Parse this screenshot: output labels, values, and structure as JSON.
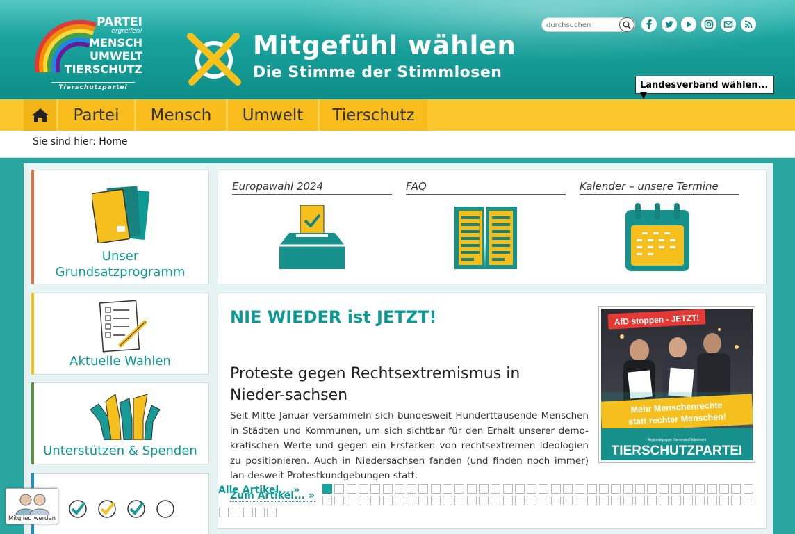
{
  "logo": {
    "line1": "PARTEI",
    "line1_sub": "ergreifen!",
    "line2": "MENSCH",
    "line3": "UMWELT",
    "line4": "TIERSCHUTZ",
    "subtitle": "Tierschutzpartei"
  },
  "claim": {
    "headline": "Mitgefühl wählen",
    "subline": "Die Stimme der Stimmlosen"
  },
  "search": {
    "placeholder": "durchsuchen"
  },
  "social_icons": [
    "facebook-icon",
    "twitter-icon",
    "youtube-icon",
    "instagram-icon",
    "mail-icon",
    "rss-icon"
  ],
  "landesverband": {
    "label": "Landesverband wählen... ▼"
  },
  "nav": {
    "items": [
      "Partei",
      "Mensch",
      "Umwelt",
      "Tierschutz"
    ]
  },
  "breadcrumb": {
    "text": "Sie sind hier: Home"
  },
  "sidebar": {
    "cards": [
      {
        "label": "Unser Grundsatzprogramm",
        "accent": "#e8733a"
      },
      {
        "label": "Aktuelle Wahlen",
        "accent": "#f2c218"
      },
      {
        "label": "Unterstützen & Spenden",
        "accent": "#5a8f3c"
      },
      {
        "label": "",
        "accent": "#1a8fd0"
      }
    ]
  },
  "quicklinks": {
    "items": [
      {
        "label": "Europawahl 2024"
      },
      {
        "label": "FAQ"
      },
      {
        "label": "Kalender – unsere Termine"
      }
    ]
  },
  "article": {
    "kicker": "NIE WIEDER ist JETZT!",
    "title": "Proteste gegen Rechtsextremismus in Nieder-sachsen",
    "body": "Seit Mitte Januar versammeln sich bundesweit Hunderttausende Menschen in Städten und Kommunen, um sich sichtbar für den Erhalt unserer demo-kratischen Werte und gegen ein Erstarken von rechtsextremen Ideologien zu positionieren. Auch in Niedersachsen fanden (und finden noch immer) lan-desweit Protestkundgebungen statt.",
    "image": {
      "banner": "AfD stoppen - JETZT!",
      "slogan": "Mehr Menschenrechte statt rechter Menschen!",
      "party": "TIERSCHUTZPARTEI",
      "sign_text": "Mehr Menschenrechte statt rechter Menschen",
      "regional": "Regionalgruppe Hannover/Hildesheim"
    },
    "read_more": "Zum Artikel... »",
    "all_articles": "Alle Artikel... »"
  },
  "slider": {
    "active_index": 0,
    "total": 77
  },
  "member_button": {
    "label": "Mitglied werden"
  },
  "colors": {
    "teal": "#1aa39d",
    "yellow": "#fbc72d",
    "text_teal": "#0e9a94"
  }
}
